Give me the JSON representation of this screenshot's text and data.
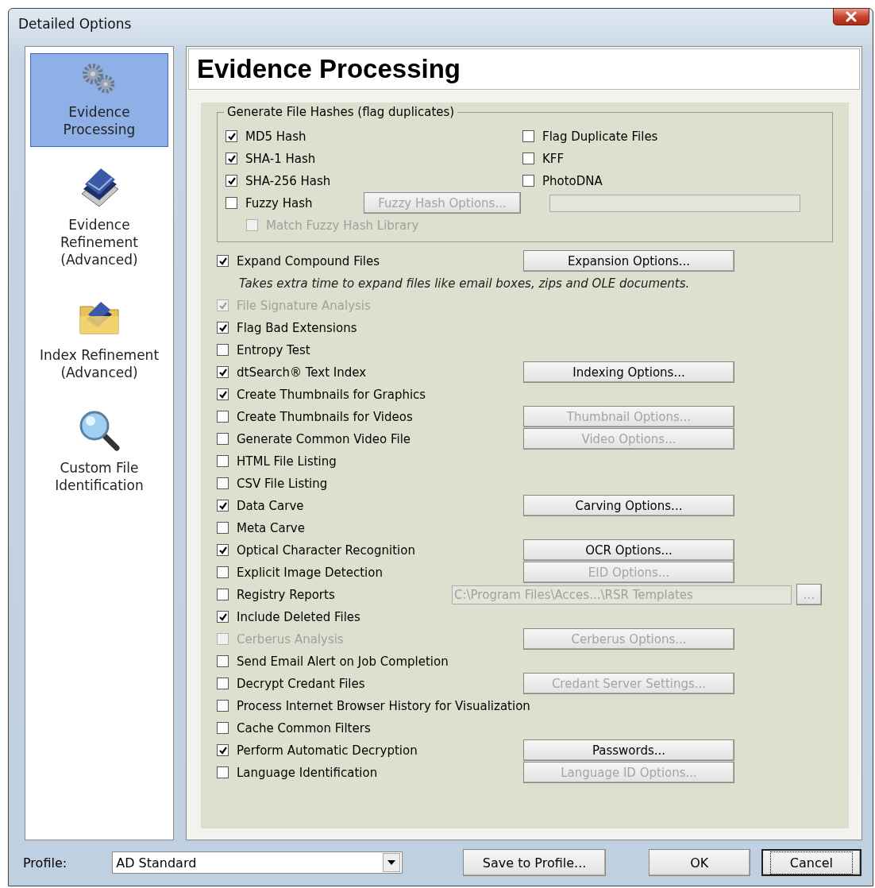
{
  "window": {
    "title": "Detailed Options"
  },
  "sidebar": {
    "items": [
      {
        "label": "Evidence\nProcessing",
        "selected": true,
        "kind": "gears"
      },
      {
        "label": "Evidence\nRefinement\n(Advanced)",
        "selected": false,
        "kind": "stack"
      },
      {
        "label": "Index Refinement\n(Advanced)",
        "selected": false,
        "kind": "folder"
      },
      {
        "label": "Custom File\nIdentification",
        "selected": false,
        "kind": "magnifier"
      }
    ]
  },
  "header": "Evidence Processing",
  "hash_group": {
    "title": "Generate File Hashes (flag duplicates)",
    "left": [
      {
        "label": "MD5 Hash",
        "checked": true,
        "disabled": false
      },
      {
        "label": "SHA-1 Hash",
        "checked": true,
        "disabled": false
      },
      {
        "label": "SHA-256 Hash",
        "checked": true,
        "disabled": false
      },
      {
        "label": "Fuzzy Hash",
        "checked": false,
        "disabled": false,
        "button": {
          "label": "Fuzzy Hash Options...",
          "disabled": true
        },
        "children": [
          {
            "label": "Match Fuzzy Hash Library",
            "checked": false,
            "disabled": true
          }
        ]
      }
    ],
    "right": [
      {
        "label": "Flag Duplicate Files",
        "checked": false,
        "disabled": false
      },
      {
        "label": "KFF",
        "checked": false,
        "disabled": false
      },
      {
        "label": "PhotoDNA",
        "checked": false,
        "disabled": false
      }
    ],
    "field": {
      "disabled": true
    }
  },
  "options": [
    {
      "label": "Expand Compound Files",
      "checked": true,
      "disabled": false,
      "button": {
        "label": "Expansion Options...",
        "disabled": false
      },
      "note": "Takes extra time to expand files like email boxes, zips and OLE documents."
    },
    {
      "label": "File Signature Analysis",
      "checked": true,
      "disabled": true
    },
    {
      "label": "Flag Bad Extensions",
      "checked": true,
      "disabled": false
    },
    {
      "label": "Entropy Test",
      "checked": false,
      "disabled": false
    },
    {
      "label": "dtSearch® Text Index",
      "checked": true,
      "disabled": false,
      "button": {
        "label": "Indexing Options...",
        "disabled": false
      }
    },
    {
      "label": "Create Thumbnails for Graphics",
      "checked": true,
      "disabled": false
    },
    {
      "label": "Create Thumbnails for Videos",
      "checked": false,
      "disabled": false,
      "button": {
        "label": "Thumbnail Options...",
        "disabled": true
      }
    },
    {
      "label": "Generate Common Video File",
      "checked": false,
      "disabled": false,
      "button": {
        "label": "Video Options...",
        "disabled": true
      }
    },
    {
      "label": "HTML File Listing",
      "checked": false,
      "disabled": false
    },
    {
      "label": "CSV File Listing",
      "checked": false,
      "disabled": false
    },
    {
      "label": "Data Carve",
      "checked": true,
      "disabled": false,
      "button": {
        "label": "Carving Options...",
        "disabled": false
      }
    },
    {
      "label": "Meta Carve",
      "checked": false,
      "disabled": false
    },
    {
      "label": "Optical Character Recognition",
      "checked": true,
      "disabled": false,
      "button": {
        "label": "OCR Options...",
        "disabled": false
      }
    },
    {
      "label": "Explicit Image Detection",
      "checked": false,
      "disabled": false,
      "button": {
        "label": "EID Options...",
        "disabled": true
      }
    },
    {
      "label": "Registry Reports",
      "checked": false,
      "disabled": false,
      "field": {
        "value": "C:\\Program Files\\Acces...\\RSR Templates",
        "disabled": true,
        "browse": "..."
      }
    },
    {
      "label": "Include Deleted Files",
      "checked": true,
      "disabled": false
    },
    {
      "label": "Cerberus Analysis",
      "checked": false,
      "disabled": true,
      "button": {
        "label": "Cerberus Options...",
        "disabled": true
      }
    },
    {
      "label": "Send Email Alert on Job Completion",
      "checked": false,
      "disabled": false
    },
    {
      "label": "Decrypt Credant Files",
      "checked": false,
      "disabled": false,
      "button": {
        "label": "Credant Server Settings...",
        "disabled": true
      }
    },
    {
      "label": "Process Internet Browser History for Visualization",
      "checked": false,
      "disabled": false
    },
    {
      "label": "Cache Common Filters",
      "checked": false,
      "disabled": false
    },
    {
      "label": "Perform Automatic Decryption",
      "checked": true,
      "disabled": false,
      "button": {
        "label": "Passwords...",
        "disabled": false
      }
    },
    {
      "label": "Language Identification",
      "checked": false,
      "disabled": false,
      "button": {
        "label": "Language ID Options...",
        "disabled": true
      }
    }
  ],
  "footer": {
    "profile_label": "Profile:",
    "profile_value": "AD Standard",
    "buttons": [
      {
        "label": "Save to Profile...",
        "focused": false
      },
      {
        "label": "OK",
        "focused": false
      },
      {
        "label": "Cancel",
        "focused": true
      }
    ]
  }
}
